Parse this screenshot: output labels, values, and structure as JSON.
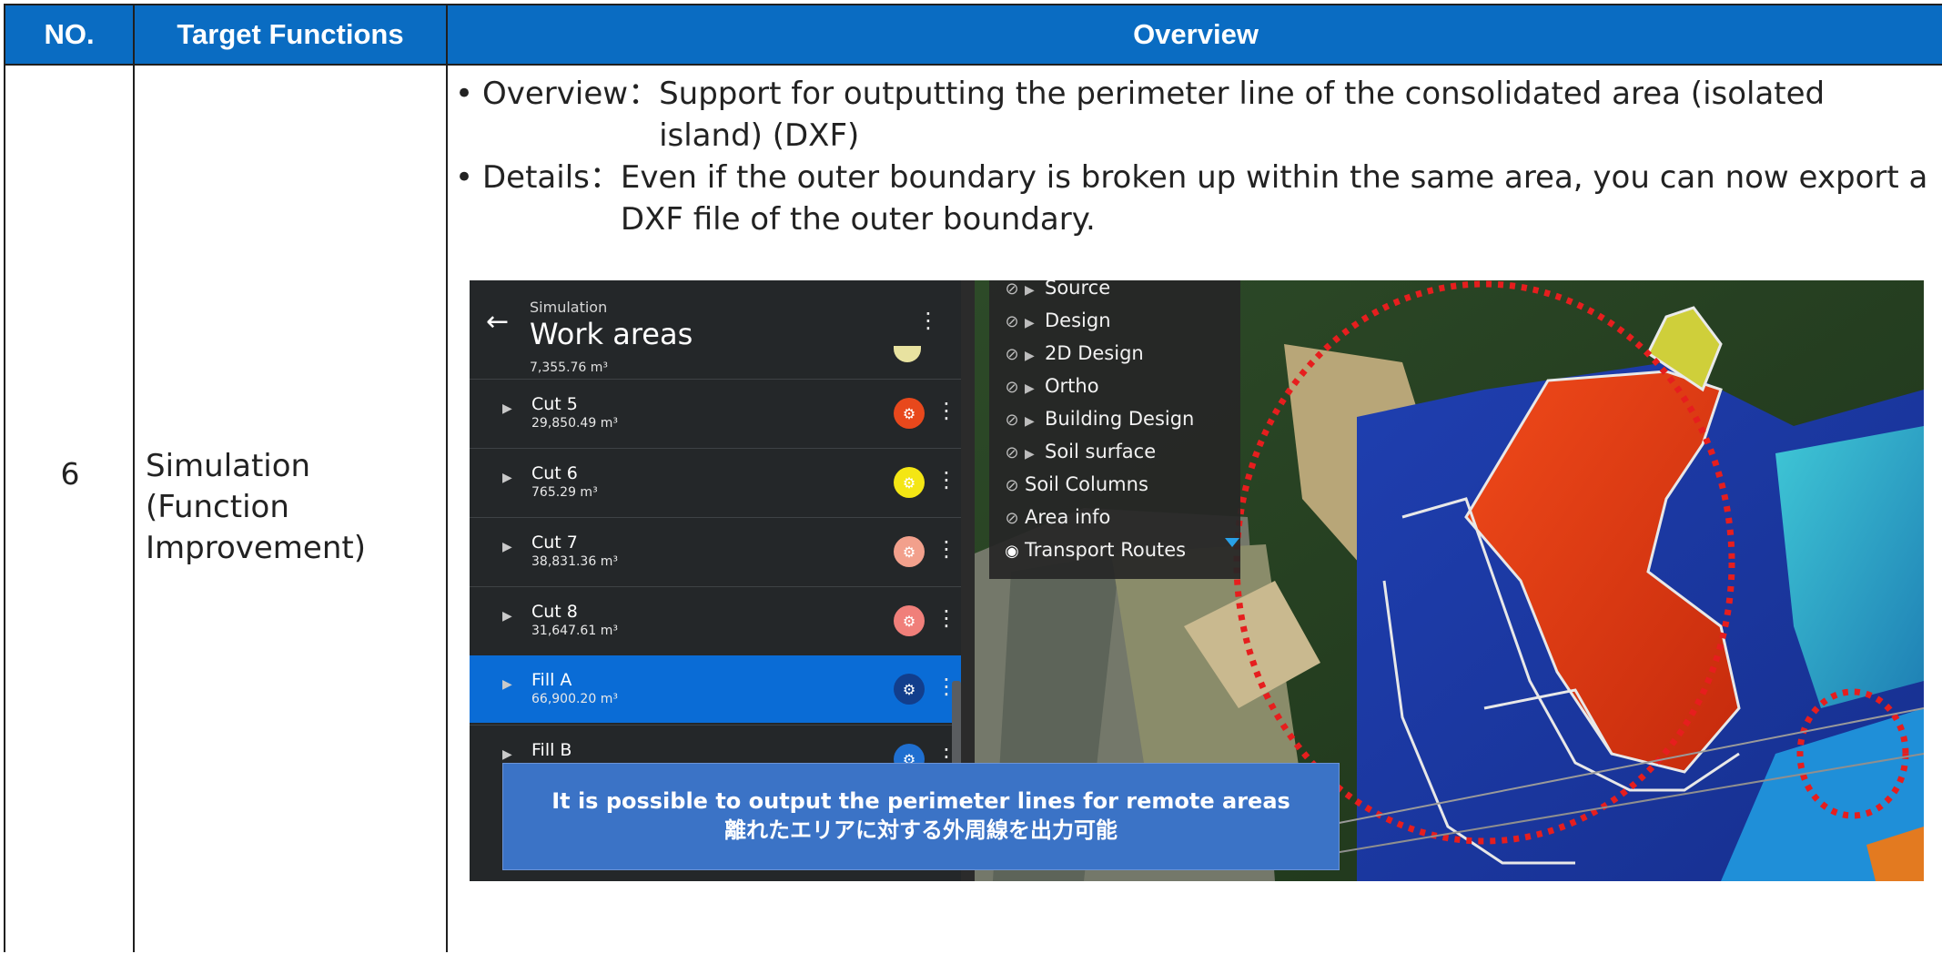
{
  "table": {
    "headers": {
      "no": "NO.",
      "target": "Target Functions",
      "overview": "Overview"
    },
    "row": {
      "no": "6",
      "target_lines": [
        "Simulation",
        "(Function",
        "Improvement)"
      ],
      "bullets": [
        {
          "label": "Overview：",
          "text": "Support for outputting the perimeter line of the consolidated area (isolated island) (DXF)"
        },
        {
          "label": "Details：",
          "text": "Even if the outer boundary is broken up within the same area, you can now export a DXF file of the outer boundary."
        }
      ]
    }
  },
  "screenshot": {
    "panel": {
      "subtitle": "Simulation",
      "title": "Work areas",
      "top_volume": "7,355.76 m³",
      "items": [
        {
          "name": "Cut 5",
          "volume": "29,850.49 m³",
          "color": "#e8481c"
        },
        {
          "name": "Cut 6",
          "volume": "765.29 m³",
          "color": "#f4e614"
        },
        {
          "name": "Cut 7",
          "volume": "38,831.36 m³",
          "color": "#f2a08c"
        },
        {
          "name": "Cut 8",
          "volume": "31,647.61 m³",
          "color": "#f07f7a"
        },
        {
          "name": "Fill A",
          "volume": "66,900.20 m³",
          "color": "#123e8c",
          "active": true
        },
        {
          "name": "Fill B",
          "volume": "",
          "color": "#1f6fd0"
        }
      ]
    },
    "layers": [
      {
        "name": "Source",
        "expandable": true,
        "visible": false
      },
      {
        "name": "Design",
        "expandable": true,
        "visible": false
      },
      {
        "name": "2D Design",
        "expandable": true,
        "visible": false
      },
      {
        "name": "Ortho",
        "expandable": true,
        "visible": false
      },
      {
        "name": "Building Design",
        "expandable": true,
        "visible": false
      },
      {
        "name": "Soil surface",
        "expandable": true,
        "visible": false
      },
      {
        "name": "Soil Columns",
        "expandable": false,
        "visible": false
      },
      {
        "name": "Area info",
        "expandable": false,
        "visible": false
      },
      {
        "name": "Transport Routes",
        "expandable": false,
        "visible": true
      }
    ],
    "callout": {
      "line_en": "It is possible to output the perimeter lines for remote areas",
      "line_ja": "離れたエリアに対する外周線を出力可能"
    },
    "colors": {
      "header_blue": "#0a6cc2",
      "fill_blue": "#1a3fb4",
      "cut_red": "#e23a12",
      "highlight_circle": "#e61e1e"
    }
  }
}
